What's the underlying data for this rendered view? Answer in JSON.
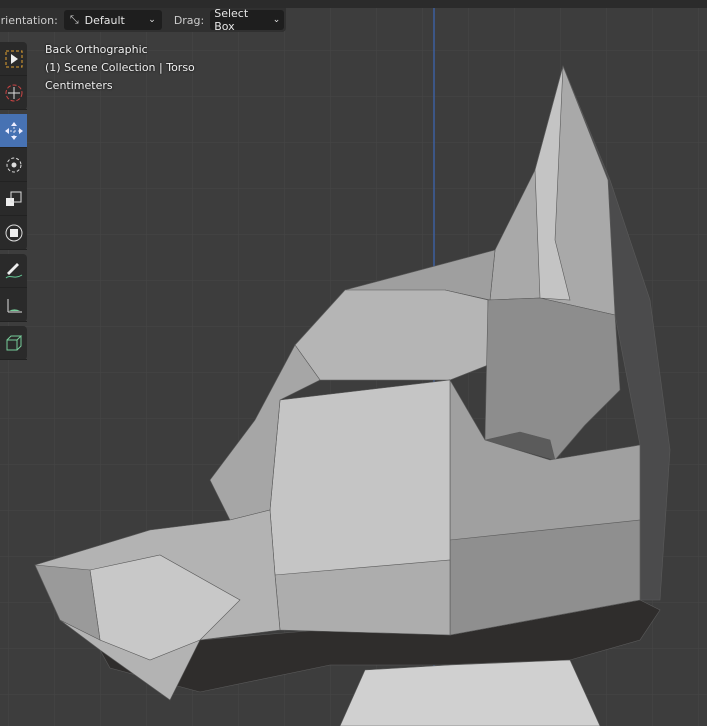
{
  "header": {
    "orientation_label": "Orientation:",
    "orientation_value": "Default",
    "drag_label": "Drag:",
    "drag_value": "Select Box"
  },
  "overlay": {
    "view_name": "Back Orthographic",
    "collection": "(1) Scene Collection | Torso",
    "units": "Centimeters"
  },
  "toolbar": {
    "tools": [
      "select-box-icon",
      "cursor-icon",
      "move-icon",
      "rotate-icon",
      "scale-icon",
      "transform-icon",
      "annotate-icon",
      "measure-icon",
      "add-cube-icon"
    ],
    "active_tool": "move-icon"
  },
  "colors": {
    "accent": "#4772b3",
    "axis_line": "#3d5f9e",
    "background": "#3d3d3d"
  }
}
